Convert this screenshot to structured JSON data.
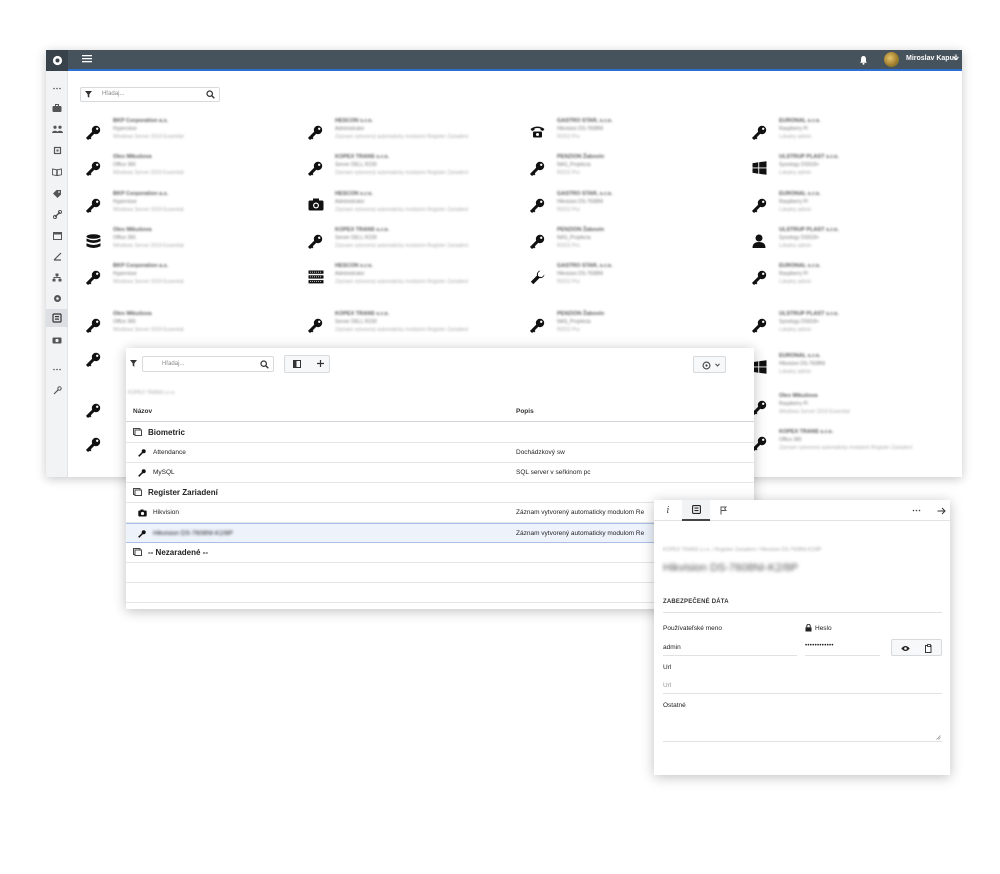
{
  "app": {
    "user_name": "Miroslav Kapuš",
    "search_placeholder": "Hľadaj..."
  },
  "panel2": {
    "search_placeholder": "Hľadaj...",
    "columns": {
      "name": "Názov",
      "description": "Popis"
    },
    "groups": [
      {
        "label": "Biometric"
      },
      {
        "label": "Register Zariadení"
      },
      {
        "label": "-- Nezaradené --"
      }
    ],
    "rows": [
      {
        "name": "Attendance",
        "description": "Dochádzkový sw"
      },
      {
        "name": "MySQL",
        "description": "SQL server v seřkinom pc"
      },
      {
        "name": "Hikvision",
        "description": "Záznam vytvorený automaticky modulom Re"
      },
      {
        "name": "",
        "description": "Záznam vytvorený automaticky modulom Re"
      }
    ]
  },
  "panel3": {
    "tabs": [
      "i",
      "",
      ""
    ],
    "section_title": "ZABEZPEČENÉ DÁTA",
    "username_label": "Používateľské meno",
    "password_label": "Heslo",
    "username_value": "admin",
    "password_value": "••••••••••••",
    "url_label": "Url",
    "url_placeholder": "Url",
    "other_label": "Ostatné"
  },
  "colors": {
    "topbar": "#46525c",
    "accent": "#2c6fd1",
    "selection": "#eef3fb"
  },
  "icons": {
    "logo": "eye-logo-icon",
    "menu": "hamburger-icon",
    "notification": "bell-icon",
    "filter": "filter-icon",
    "search": "search-icon",
    "key": "key-icon",
    "camera": "camera-icon",
    "phone": "phone-icon",
    "database": "database-icon",
    "windows": "windows-icon",
    "user": "user-icon",
    "wrench": "wrench-icon",
    "rack": "server-rack-icon"
  }
}
